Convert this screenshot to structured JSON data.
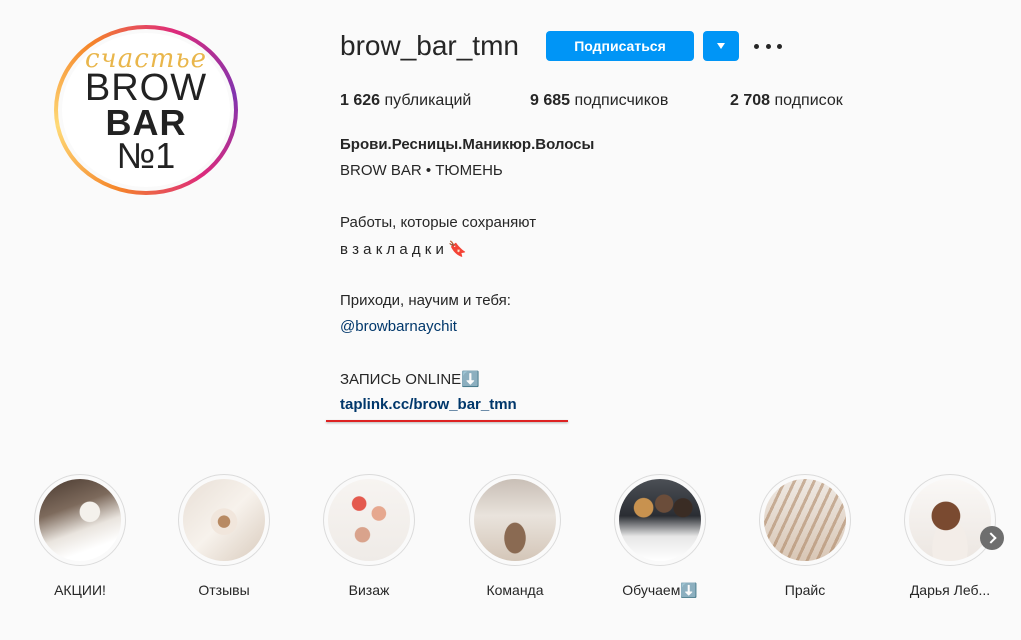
{
  "profile": {
    "username": "brow_bar_tmn",
    "follow_label": "Подписаться",
    "logo": {
      "script": "счастье",
      "line1": "BROW",
      "line2": "BAR",
      "line3": "№1"
    }
  },
  "stats": {
    "posts_count": "1 626",
    "posts_label": "публикаций",
    "followers_count": "9 685",
    "followers_label": "подписчиков",
    "following_count": "2 708",
    "following_label": "подписок"
  },
  "bio": {
    "title": "Брови.Ресницы.Маникюр.Волосы",
    "line1": "BROW BAR • ТЮМЕНЬ",
    "line2": "Работы, которые сохраняют",
    "line3": "в з а к л а д к и 🔖",
    "line4": "Приходи, научим и тебя:",
    "mention": "@browbarnaychit",
    "line5": "ЗАПИСЬ ONLINE⬇️",
    "external_link": "taplink.cc/brow_bar_tmn"
  },
  "highlights": [
    {
      "label": "АКЦИИ!"
    },
    {
      "label": "Отзывы"
    },
    {
      "label": "Визаж"
    },
    {
      "label": "Команда"
    },
    {
      "label": "Обучаем⬇️"
    },
    {
      "label": "Прайс"
    },
    {
      "label": "Дарья Леб..."
    }
  ],
  "colors": {
    "accent": "#0095f6",
    "link": "#00376b",
    "annotation": "#dd2222"
  }
}
